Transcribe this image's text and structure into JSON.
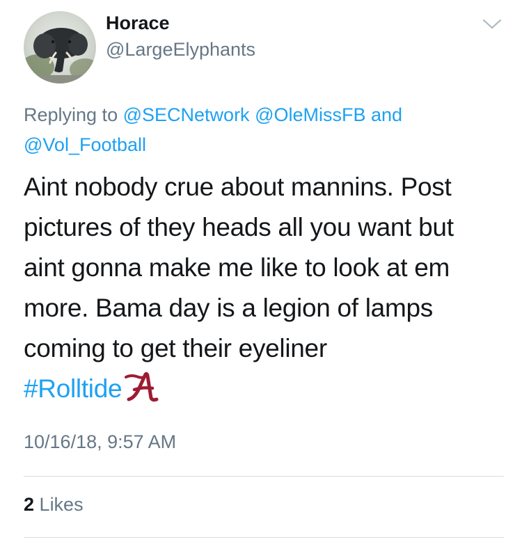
{
  "tweet": {
    "author": {
      "display_name": "Horace",
      "handle": "@LargeElyphants",
      "avatar_subject": "elephant-photo"
    },
    "menu_icon": "chevron-down-icon",
    "replying": {
      "prefix": "Replying to",
      "mention_1": "@SECNetwork",
      "mention_2": "@OleMissFB",
      "conjunction": "and",
      "mention_3": "@Vol_Football"
    },
    "text_lines": [
      "Aint nobody crue about mannins. Post",
      "pictures of they heads all you want but",
      "aint gonna make me like to look at em",
      "more. Bama day is a legion of lamps",
      "coming to get their eyeliner"
    ],
    "hashtag": "#Rolltide",
    "emoji": "alabama-script-a",
    "timestamp": "10/16/18, 9:57 AM",
    "likes": {
      "count": "2",
      "label": "Likes"
    }
  },
  "colors": {
    "link": "#1da1f2",
    "secondary_text": "#657786",
    "primary_text": "#14171a",
    "divider": "#d7dde2",
    "alabama_crimson": "#9e1b32"
  }
}
